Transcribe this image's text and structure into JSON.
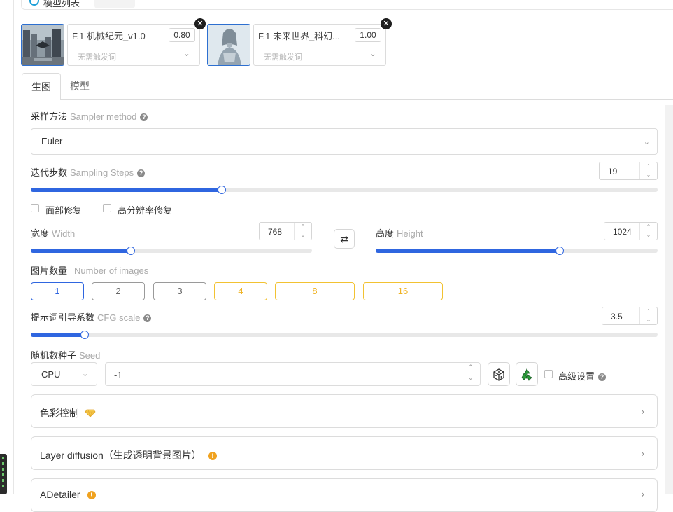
{
  "colors": {
    "accent": "#2f66e0",
    "premium": "#f2c232",
    "border": "#dcdcdc"
  },
  "top": {
    "tab_label": "模型列表"
  },
  "loras": [
    {
      "name": "F.1 机械纪元_v1.0",
      "weight": "0.80",
      "trigger_placeholder": "无需触发词"
    },
    {
      "name": "F.1 未来世界_科幻...",
      "weight": "1.00",
      "trigger_placeholder": "无需触发词"
    }
  ],
  "tabs": [
    {
      "label": "生图",
      "active": true
    },
    {
      "label": "模型",
      "active": false
    }
  ],
  "sampler": {
    "label_cn": "采样方法",
    "label_en": "Sampler method",
    "value": "Euler"
  },
  "steps": {
    "label_cn": "迭代步数",
    "label_en": "Sampling Steps",
    "value": "19",
    "min": 1,
    "max": 60,
    "current": 19
  },
  "options": {
    "face_fix": "面部修复",
    "hires_fix": "高分辨率修复"
  },
  "width": {
    "label_cn": "宽度",
    "label_en": "Width",
    "value": "768",
    "min": 64,
    "max": 2048,
    "current": 768
  },
  "height": {
    "label_cn": "高度",
    "label_en": "Height",
    "value": "1024",
    "min": 64,
    "max": 1536,
    "current": 1024
  },
  "swap_icon": "swap-arrows-icon",
  "num_images": {
    "label_cn": "图片数量",
    "label_en": "Number of images",
    "options": [
      "1",
      "2",
      "3",
      "4",
      "8",
      "16"
    ],
    "selected": "1"
  },
  "cfg": {
    "label_cn": "提示词引导系数",
    "label_en": "CFG scale",
    "value": "3.5",
    "min": 1,
    "max": 30,
    "current": 3.5
  },
  "seed": {
    "label_cn": "随机数种子",
    "label_en": "Seed",
    "device": "CPU",
    "value": "-1",
    "advanced": "高级设置"
  },
  "panels": [
    {
      "title": "色彩控制"
    },
    {
      "title": "Layer diffusion（生成透明背景图片）"
    },
    {
      "title": "ADetailer"
    }
  ]
}
